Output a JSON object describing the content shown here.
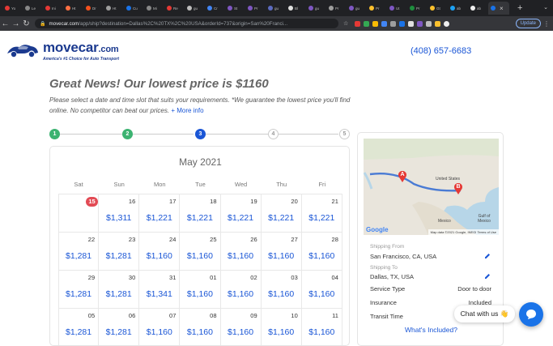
{
  "browser": {
    "tabs": [
      {
        "label": "Yo",
        "color": "#e53935"
      },
      {
        "label": "Le",
        "color": "#888888"
      },
      {
        "label": "Ini",
        "color": "#e53935"
      },
      {
        "label": "Ht",
        "color": "#ff7043"
      },
      {
        "label": "Dr",
        "color": "#f4511e"
      },
      {
        "label": "Ht",
        "color": "#9e9e9e"
      },
      {
        "label": "Cu",
        "color": "#1a73e8"
      },
      {
        "label": "Mi",
        "color": "#888888"
      },
      {
        "label": "Re",
        "color": "#e53935"
      },
      {
        "label": "gu",
        "color": "#bdbdbd"
      },
      {
        "label": "Cr",
        "color": "#4285f4"
      },
      {
        "label": "St",
        "color": "#7e57c2"
      },
      {
        "label": "Pr",
        "color": "#7e57c2"
      },
      {
        "label": "gu",
        "color": "#5c6bc0"
      },
      {
        "label": "Bl",
        "color": "#e0e0e0"
      },
      {
        "label": "gu",
        "color": "#7e57c2"
      },
      {
        "label": "Pr",
        "color": "#9e9e9e"
      },
      {
        "label": "gu",
        "color": "#7e57c2"
      },
      {
        "label": "Pr",
        "color": "#fbc02d"
      },
      {
        "label": "Ut",
        "color": "#7e57c2"
      },
      {
        "label": "Pr",
        "color": "#1e8e3e"
      },
      {
        "label": "Gt",
        "color": "#fbc02d"
      },
      {
        "label": "ab",
        "color": "#1da1f2"
      },
      {
        "label": "ab",
        "color": "#eeeeee"
      },
      {
        "label": "",
        "color": "#1a73e8"
      }
    ],
    "url_host": "movecar.com",
    "url_path": "/app/ship?destination=Dallas%2C%20TX%2C%20USA&orderId=737&origin=San%20Franci...",
    "update_label": "Update",
    "colors": {
      "chrome_dark": "#202124",
      "chrome_bar": "#35363a",
      "omnibox_host": "#e8eaed"
    }
  },
  "header": {
    "brand": "movecar",
    "brand_suffix": ".com",
    "tagline": "America's #1 Choice for Auto Transport",
    "phone": "(408) 657-6683"
  },
  "intro": {
    "headline": "Great News! Our lowest price is $1160",
    "subtext": "Please select a date and time slot that suits your requirements. *We guarantee the lowest price you'll find online. No competitor can beat our prices.",
    "more_link": "+ More info"
  },
  "steps": {
    "items": [
      "1",
      "2",
      "3",
      "4",
      "5"
    ],
    "states": [
      "done",
      "done",
      "cur",
      "todo",
      "todo"
    ]
  },
  "calendar": {
    "month": "May 2021",
    "weekdays": [
      "Sat",
      "Sun",
      "Mon",
      "Tue",
      "Wed",
      "Thu",
      "Fri"
    ],
    "weeks": [
      [
        {
          "day": "15",
          "price": "",
          "today": true
        },
        {
          "day": "16",
          "price": "$1,311"
        },
        {
          "day": "17",
          "price": "$1,221"
        },
        {
          "day": "18",
          "price": "$1,221"
        },
        {
          "day": "19",
          "price": "$1,221"
        },
        {
          "day": "20",
          "price": "$1,221"
        },
        {
          "day": "21",
          "price": "$1,221"
        }
      ],
      [
        {
          "day": "22",
          "price": "$1,281"
        },
        {
          "day": "23",
          "price": "$1,281"
        },
        {
          "day": "24",
          "price": "$1,160"
        },
        {
          "day": "25",
          "price": "$1,160"
        },
        {
          "day": "26",
          "price": "$1,160"
        },
        {
          "day": "27",
          "price": "$1,160"
        },
        {
          "day": "28",
          "price": "$1,160"
        }
      ],
      [
        {
          "day": "29",
          "price": "$1,281"
        },
        {
          "day": "30",
          "price": "$1,281"
        },
        {
          "day": "31",
          "price": "$1,341"
        },
        {
          "day": "01",
          "price": "$1,160"
        },
        {
          "day": "02",
          "price": "$1,160"
        },
        {
          "day": "03",
          "price": "$1,160"
        },
        {
          "day": "04",
          "price": "$1,160"
        }
      ],
      [
        {
          "day": "05",
          "price": "$1,281"
        },
        {
          "day": "06",
          "price": "$1,281"
        },
        {
          "day": "07",
          "price": "$1,160"
        },
        {
          "day": "08",
          "price": "$1,160"
        },
        {
          "day": "09",
          "price": "$1,160"
        },
        {
          "day": "10",
          "price": "$1,160"
        },
        {
          "day": "11",
          "price": "$1,160"
        }
      ]
    ]
  },
  "map": {
    "pin_a": "A",
    "pin_b": "B",
    "country_label": "United States",
    "mexico_label": "Mexico",
    "gulf_label": "Gulf of Mexico",
    "google": "Google",
    "footer": "Map data ©2021 Google, INEGI   Terms of Use"
  },
  "details": {
    "from_label": "Shipping From",
    "from_value": "San Francisco, CA, USA",
    "to_label": "Shipping To",
    "to_value": "Dallas, TX, USA",
    "rows": [
      {
        "label": "Service Type",
        "value": "Door to door"
      },
      {
        "label": "Insurance",
        "value": "Included"
      },
      {
        "label": "Transit Time",
        "value": ""
      }
    ],
    "included_link": "What's Included?"
  },
  "chat": {
    "label": "Chat with us 👋",
    "accent": "#1a73e8"
  }
}
